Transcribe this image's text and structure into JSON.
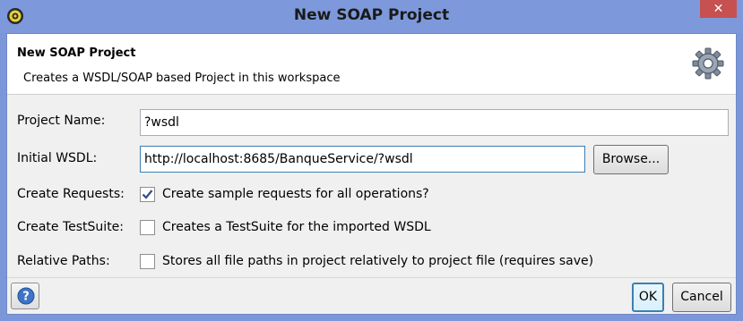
{
  "window": {
    "title": "New SOAP Project",
    "close_label": "✕"
  },
  "header": {
    "title": "New SOAP Project",
    "description": "Creates a WSDL/SOAP based Project in this workspace"
  },
  "form": {
    "project_name_label": "Project Name:",
    "project_name_value": "?wsdl",
    "initial_wsdl_label": "Initial WSDL:",
    "initial_wsdl_value": "http://localhost:8685/BanqueService/?wsdl",
    "browse_label": "Browse...",
    "create_requests_label": "Create Requests:",
    "create_requests_checked": true,
    "create_requests_desc": "Create sample requests for all operations?",
    "create_testsuite_label": "Create TestSuite:",
    "create_testsuite_checked": false,
    "create_testsuite_desc": "Creates a TestSuite for the imported WSDL",
    "relative_paths_label": "Relative Paths:",
    "relative_paths_checked": false,
    "relative_paths_desc": "Stores all file paths in project relatively to project file (requires save)"
  },
  "footer": {
    "ok_label": "OK",
    "cancel_label": "Cancel"
  },
  "icons": {
    "app": "soapui-icon",
    "header": "gear-icon",
    "help": "help-icon"
  },
  "colors": {
    "titlebar": "#7d99db",
    "close": "#c75050",
    "checkmark": "#2b4d8c"
  }
}
